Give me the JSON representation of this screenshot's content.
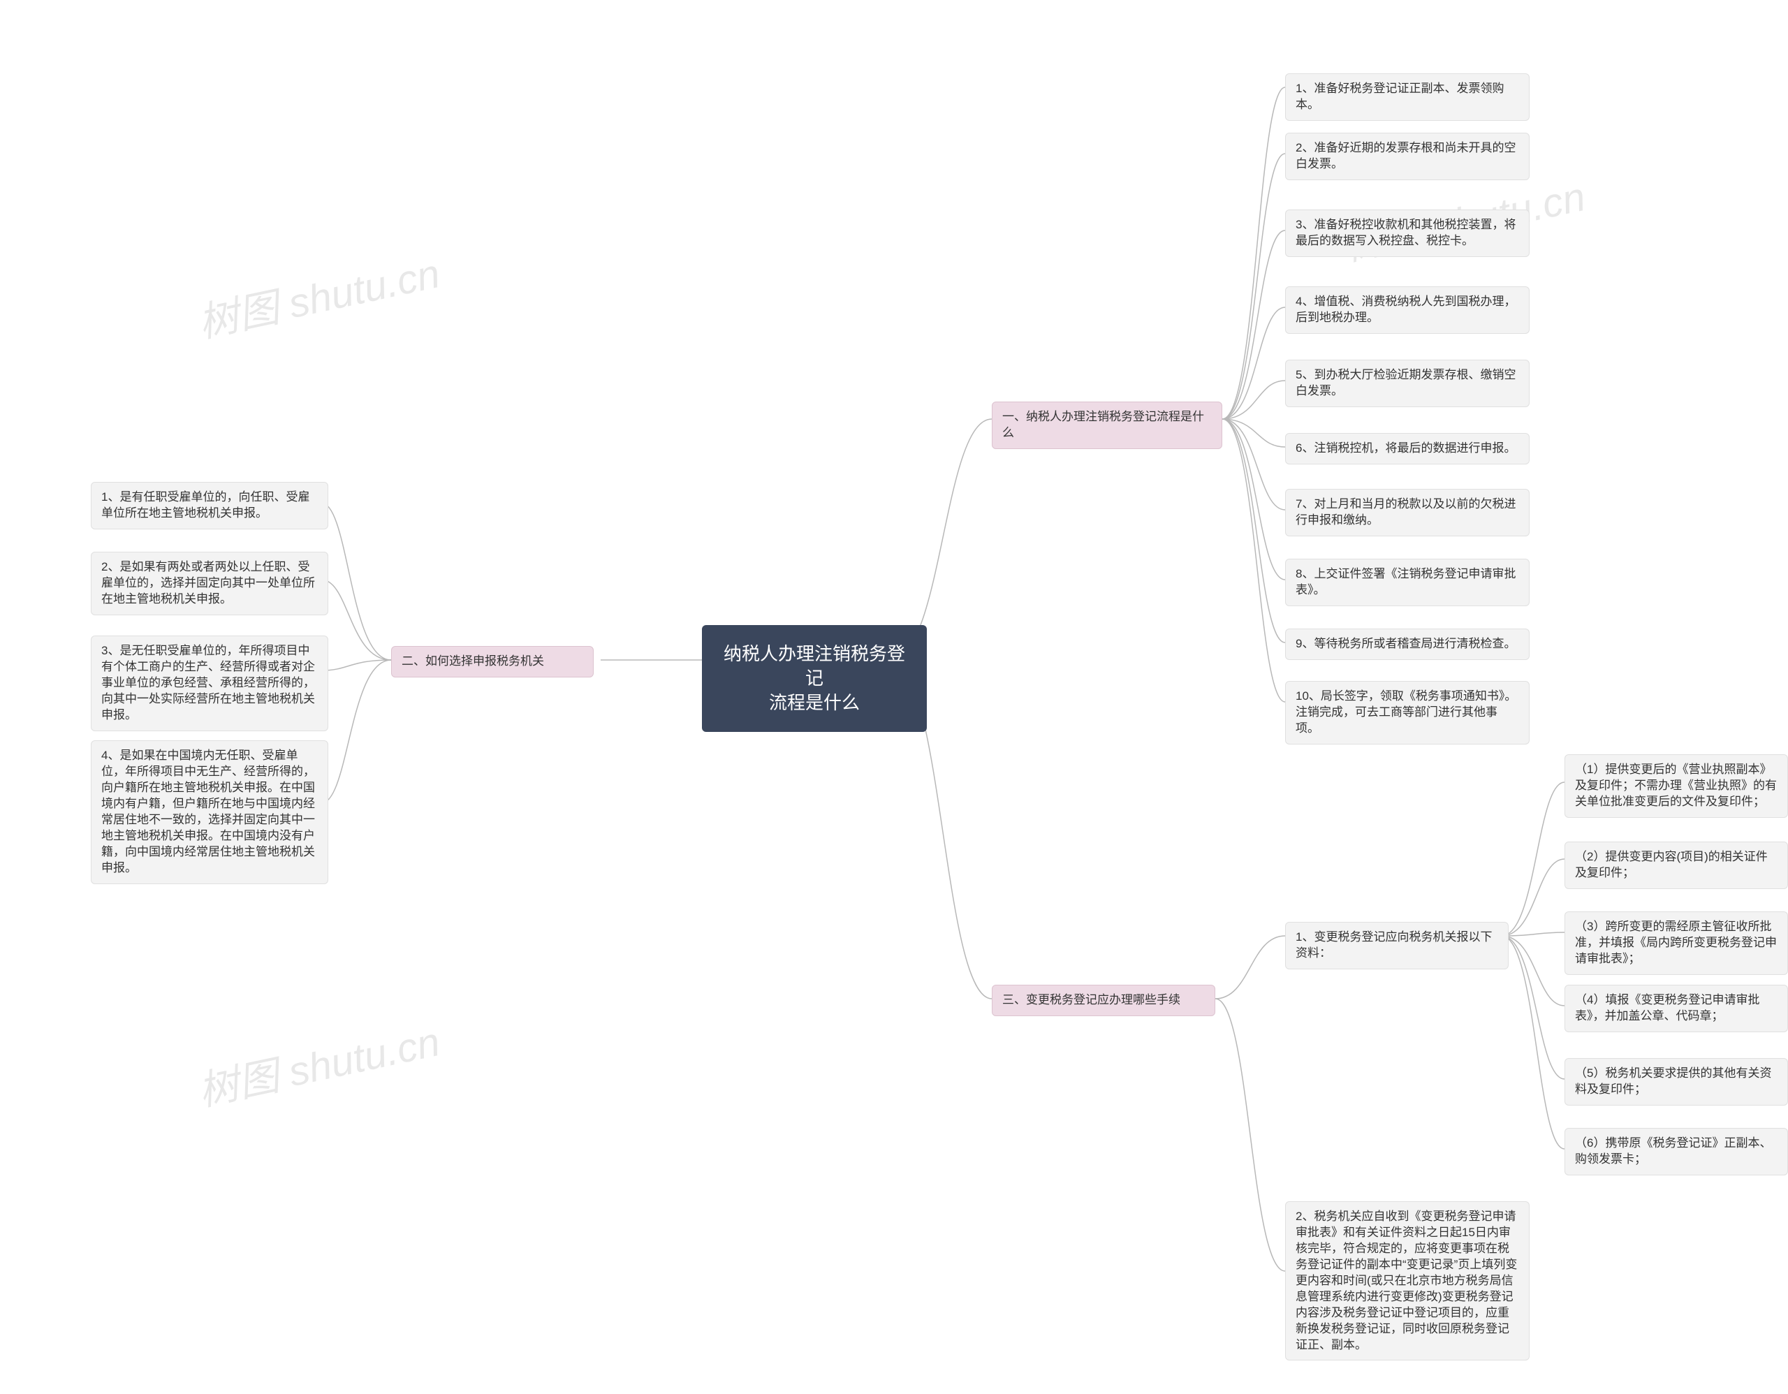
{
  "root": {
    "title_l1": "纳税人办理注销税务登记",
    "title_l2": "流程是什么"
  },
  "branch1": {
    "label": "一、纳税人办理注销税务登记流程是什么",
    "items": [
      "1、准备好税务登记证正副本、发票领购本。",
      "2、准备好近期的发票存根和尚未开具的空白发票。",
      "3、准备好税控收款机和其他税控装置，将最后的数据写入税控盘、税控卡。",
      "4、增值税、消费税纳税人先到国税办理，后到地税办理。",
      "5、到办税大厅检验近期发票存根、缴销空白发票。",
      "6、注销税控机，将最后的数据进行申报。",
      "7、对上月和当月的税款以及以前的欠税进行申报和缴纳。",
      "8、上交证件签署《注销税务登记申请审批表》。",
      "9、等待税务所或者稽查局进行清税检查。",
      "10、局长签字，领取《税务事项通知书》。注销完成，可去工商等部门进行其他事项。"
    ]
  },
  "branch2": {
    "label": "二、如何选择申报税务机关",
    "items": [
      "1、是有任职受雇单位的，向任职、受雇单位所在地主管地税机关申报。",
      "2、是如果有两处或者两处以上任职、受雇单位的，选择并固定向其中一处单位所在地主管地税机关申报。",
      "3、是无任职受雇单位的，年所得项目中有个体工商户的生产、经营所得或者对企事业单位的承包经营、承租经营所得的，向其中一处实际经营所在地主管地税机关申报。",
      "4、是如果在中国境内无任职、受雇单位，年所得项目中无生产、经营所得的，向户籍所在地主管地税机关申报。在中国境内有户籍，但户籍所在地与中国境内经常居住地不一致的，选择并固定向其中一地主管地税机关申报。在中国境内没有户籍，向中国境内经常居住地主管地税机关申报。"
    ]
  },
  "branch3": {
    "label": "三、变更税务登记应办理哪些手续",
    "child1": {
      "label": "1、变更税务登记应向税务机关报以下资料：",
      "items": [
        "（1）提供变更后的《营业执照副本》及复印件；不需办理《营业执照》的有关单位批准变更后的文件及复印件；",
        "（2）提供变更内容(项目)的相关证件及复印件；",
        "（3）跨所变更的需经原主管征收所批准，并填报《局内跨所变更税务登记申请审批表》；",
        "（4）填报《变更税务登记申请审批表》，并加盖公章、代码章；",
        "（5）税务机关要求提供的其他有关资料及复印件；",
        "（6）携带原《税务登记证》正副本、购领发票卡；"
      ]
    },
    "child2": "2、税务机关应自收到《变更税务登记申请审批表》和有关证件资料之日起15日内审核完毕，符合规定的，应将变更事项在税务登记证件的副本中“变更记录”页上填列变更内容和时间(或只在北京市地方税务局信息管理系统内进行变更修改)变更税务登记内容涉及税务登记证中登记项目的，应重新换发税务登记证，同时收回原税务登记证正、副本。"
  },
  "watermark": "树图 shutu.cn"
}
